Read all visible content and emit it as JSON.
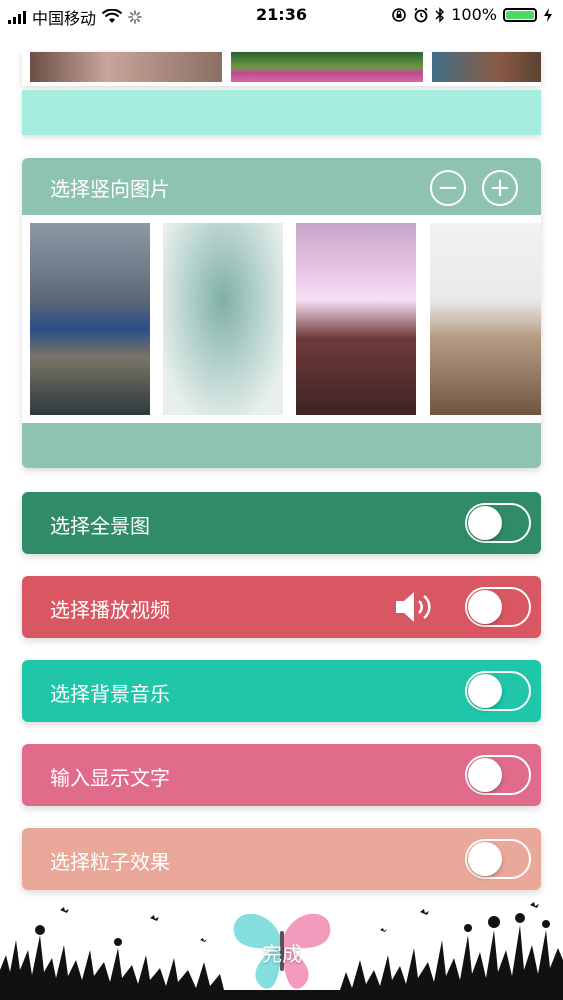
{
  "status_bar": {
    "carrier": "中国移动",
    "time": "21:36",
    "battery_percent": "100%",
    "battery_level": 1.0
  },
  "vertical_section": {
    "title": "选择竖向图片",
    "minus_symbol": "−",
    "plus_symbol": "+"
  },
  "rows": [
    {
      "label": "选择全景图",
      "color": "#2f8c66",
      "toggle_on": false
    },
    {
      "label": "选择播放视频",
      "color": "#d95763",
      "toggle_on": false
    },
    {
      "label": "选择背景音乐",
      "color": "#1fc6a8",
      "toggle_on": false
    },
    {
      "label": "输入显示文字",
      "color": "#e06b8a",
      "toggle_on": false
    },
    {
      "label": "选择粒子效果",
      "color": "#e9a899",
      "toggle_on": false
    }
  ],
  "done_button": {
    "label": "完成"
  }
}
